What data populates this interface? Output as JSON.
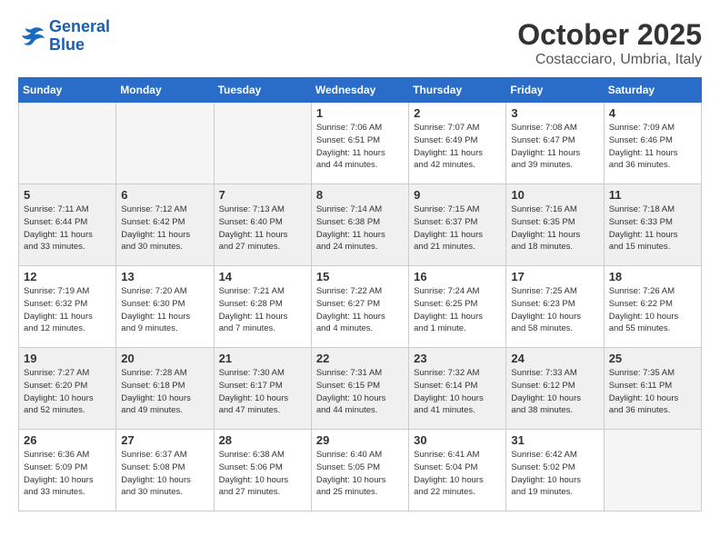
{
  "logo": {
    "line1": "General",
    "line2": "Blue"
  },
  "title": "October 2025",
  "location": "Costacciaro, Umbria, Italy",
  "weekdays": [
    "Sunday",
    "Monday",
    "Tuesday",
    "Wednesday",
    "Thursday",
    "Friday",
    "Saturday"
  ],
  "weeks": [
    [
      {
        "day": "",
        "info": ""
      },
      {
        "day": "",
        "info": ""
      },
      {
        "day": "",
        "info": ""
      },
      {
        "day": "1",
        "info": "Sunrise: 7:06 AM\nSunset: 6:51 PM\nDaylight: 11 hours\nand 44 minutes."
      },
      {
        "day": "2",
        "info": "Sunrise: 7:07 AM\nSunset: 6:49 PM\nDaylight: 11 hours\nand 42 minutes."
      },
      {
        "day": "3",
        "info": "Sunrise: 7:08 AM\nSunset: 6:47 PM\nDaylight: 11 hours\nand 39 minutes."
      },
      {
        "day": "4",
        "info": "Sunrise: 7:09 AM\nSunset: 6:46 PM\nDaylight: 11 hours\nand 36 minutes."
      }
    ],
    [
      {
        "day": "5",
        "info": "Sunrise: 7:11 AM\nSunset: 6:44 PM\nDaylight: 11 hours\nand 33 minutes."
      },
      {
        "day": "6",
        "info": "Sunrise: 7:12 AM\nSunset: 6:42 PM\nDaylight: 11 hours\nand 30 minutes."
      },
      {
        "day": "7",
        "info": "Sunrise: 7:13 AM\nSunset: 6:40 PM\nDaylight: 11 hours\nand 27 minutes."
      },
      {
        "day": "8",
        "info": "Sunrise: 7:14 AM\nSunset: 6:38 PM\nDaylight: 11 hours\nand 24 minutes."
      },
      {
        "day": "9",
        "info": "Sunrise: 7:15 AM\nSunset: 6:37 PM\nDaylight: 11 hours\nand 21 minutes."
      },
      {
        "day": "10",
        "info": "Sunrise: 7:16 AM\nSunset: 6:35 PM\nDaylight: 11 hours\nand 18 minutes."
      },
      {
        "day": "11",
        "info": "Sunrise: 7:18 AM\nSunset: 6:33 PM\nDaylight: 11 hours\nand 15 minutes."
      }
    ],
    [
      {
        "day": "12",
        "info": "Sunrise: 7:19 AM\nSunset: 6:32 PM\nDaylight: 11 hours\nand 12 minutes."
      },
      {
        "day": "13",
        "info": "Sunrise: 7:20 AM\nSunset: 6:30 PM\nDaylight: 11 hours\nand 9 minutes."
      },
      {
        "day": "14",
        "info": "Sunrise: 7:21 AM\nSunset: 6:28 PM\nDaylight: 11 hours\nand 7 minutes."
      },
      {
        "day": "15",
        "info": "Sunrise: 7:22 AM\nSunset: 6:27 PM\nDaylight: 11 hours\nand 4 minutes."
      },
      {
        "day": "16",
        "info": "Sunrise: 7:24 AM\nSunset: 6:25 PM\nDaylight: 11 hours\nand 1 minute."
      },
      {
        "day": "17",
        "info": "Sunrise: 7:25 AM\nSunset: 6:23 PM\nDaylight: 10 hours\nand 58 minutes."
      },
      {
        "day": "18",
        "info": "Sunrise: 7:26 AM\nSunset: 6:22 PM\nDaylight: 10 hours\nand 55 minutes."
      }
    ],
    [
      {
        "day": "19",
        "info": "Sunrise: 7:27 AM\nSunset: 6:20 PM\nDaylight: 10 hours\nand 52 minutes."
      },
      {
        "day": "20",
        "info": "Sunrise: 7:28 AM\nSunset: 6:18 PM\nDaylight: 10 hours\nand 49 minutes."
      },
      {
        "day": "21",
        "info": "Sunrise: 7:30 AM\nSunset: 6:17 PM\nDaylight: 10 hours\nand 47 minutes."
      },
      {
        "day": "22",
        "info": "Sunrise: 7:31 AM\nSunset: 6:15 PM\nDaylight: 10 hours\nand 44 minutes."
      },
      {
        "day": "23",
        "info": "Sunrise: 7:32 AM\nSunset: 6:14 PM\nDaylight: 10 hours\nand 41 minutes."
      },
      {
        "day": "24",
        "info": "Sunrise: 7:33 AM\nSunset: 6:12 PM\nDaylight: 10 hours\nand 38 minutes."
      },
      {
        "day": "25",
        "info": "Sunrise: 7:35 AM\nSunset: 6:11 PM\nDaylight: 10 hours\nand 36 minutes."
      }
    ],
    [
      {
        "day": "26",
        "info": "Sunrise: 6:36 AM\nSunset: 5:09 PM\nDaylight: 10 hours\nand 33 minutes."
      },
      {
        "day": "27",
        "info": "Sunrise: 6:37 AM\nSunset: 5:08 PM\nDaylight: 10 hours\nand 30 minutes."
      },
      {
        "day": "28",
        "info": "Sunrise: 6:38 AM\nSunset: 5:06 PM\nDaylight: 10 hours\nand 27 minutes."
      },
      {
        "day": "29",
        "info": "Sunrise: 6:40 AM\nSunset: 5:05 PM\nDaylight: 10 hours\nand 25 minutes."
      },
      {
        "day": "30",
        "info": "Sunrise: 6:41 AM\nSunset: 5:04 PM\nDaylight: 10 hours\nand 22 minutes."
      },
      {
        "day": "31",
        "info": "Sunrise: 6:42 AM\nSunset: 5:02 PM\nDaylight: 10 hours\nand 19 minutes."
      },
      {
        "day": "",
        "info": ""
      }
    ]
  ]
}
